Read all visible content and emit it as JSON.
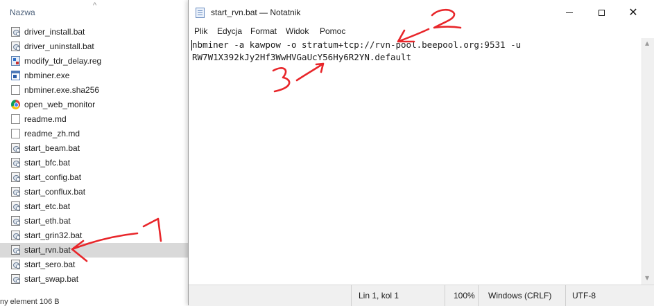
{
  "explorer": {
    "column_name": "Nazwa",
    "files": [
      {
        "name": "driver_install.bat",
        "icon": "bat-file-icon"
      },
      {
        "name": "driver_uninstall.bat",
        "icon": "bat-file-icon"
      },
      {
        "name": "modify_tdr_delay.reg",
        "icon": "reg-file-icon"
      },
      {
        "name": "nbminer.exe",
        "icon": "exe-file-icon"
      },
      {
        "name": "nbminer.exe.sha256",
        "icon": "file-icon"
      },
      {
        "name": "open_web_monitor",
        "icon": "chrome-icon"
      },
      {
        "name": "readme.md",
        "icon": "file-icon"
      },
      {
        "name": "readme_zh.md",
        "icon": "file-icon"
      },
      {
        "name": "start_beam.bat",
        "icon": "bat-file-icon"
      },
      {
        "name": "start_bfc.bat",
        "icon": "bat-file-icon"
      },
      {
        "name": "start_config.bat",
        "icon": "bat-file-icon"
      },
      {
        "name": "start_conflux.bat",
        "icon": "bat-file-icon"
      },
      {
        "name": "start_etc.bat",
        "icon": "bat-file-icon"
      },
      {
        "name": "start_eth.bat",
        "icon": "bat-file-icon"
      },
      {
        "name": "start_grin32.bat",
        "icon": "bat-file-icon"
      },
      {
        "name": "start_rvn.bat",
        "icon": "bat-file-icon",
        "selected": true
      },
      {
        "name": "start_sero.bat",
        "icon": "bat-file-icon"
      },
      {
        "name": "start_swap.bat",
        "icon": "bat-file-icon"
      }
    ],
    "status": "ny element  106 B"
  },
  "notepad": {
    "title": "start_rvn.bat — Notatnik",
    "menu": [
      "Plik",
      "Edycja",
      "Format",
      "Widok",
      "Pomoc"
    ],
    "content_lines": [
      "nbminer -a kawpow -o stratum+tcp://rvn-pool.beepool.org:9531 -u",
      "RW7W1X392kJy2Hf3WwHVGaUcY56Hy6R2YN.default"
    ],
    "status": {
      "position": "Lin 1, kol 1",
      "zoom": "100%",
      "line_ending": "Windows (CRLF)",
      "encoding": "UTF-8"
    }
  },
  "annotations": {
    "color": "#e8262a",
    "labels": [
      "1",
      "2",
      "3"
    ]
  }
}
